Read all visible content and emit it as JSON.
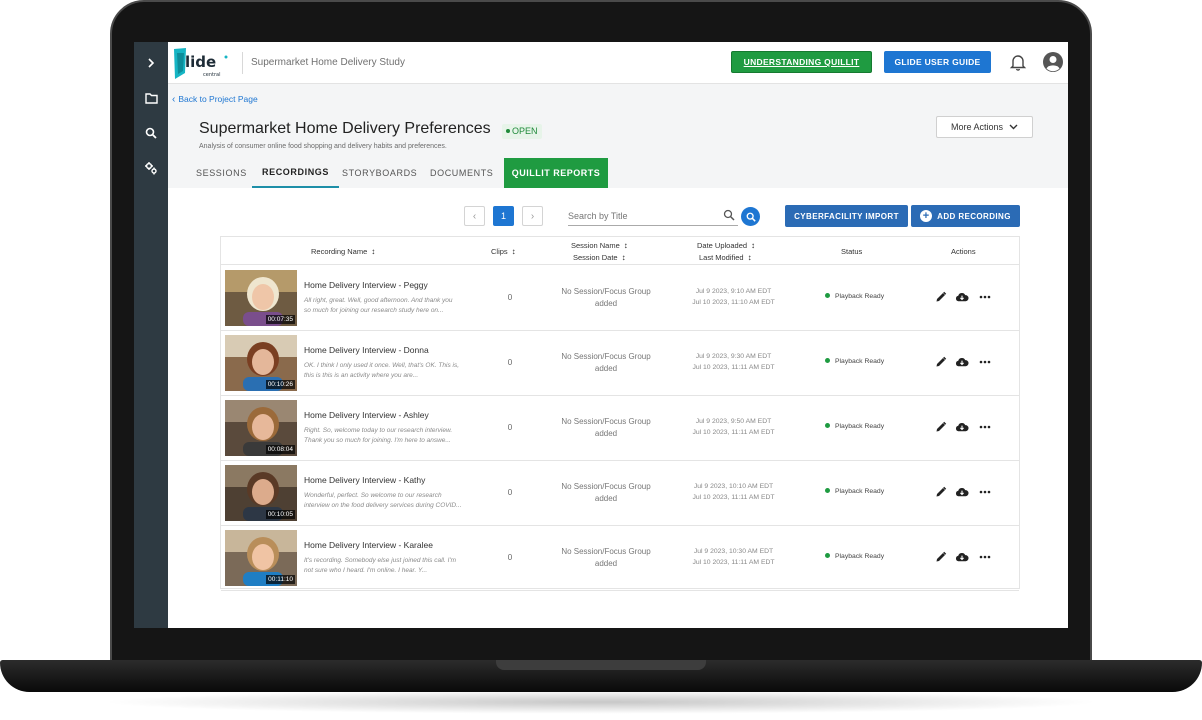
{
  "app": {
    "study_title": "Supermarket Home Delivery Study",
    "understanding_button": "UNDERSTANDING QUILLIT",
    "user_guide_button": "GLIDE USER GUIDE",
    "logo_alt": "glide central"
  },
  "rail": {
    "items": [
      "chevron-right-icon",
      "folder-icon",
      "search-icon",
      "settings-icon"
    ]
  },
  "header": {
    "back_label": "Back to Project Page",
    "title": "Supermarket Home Delivery Preferences",
    "status_badge": "OPEN",
    "subtitle": "Analysis of consumer online food shopping and delivery habits and preferences.",
    "more_actions": "More Actions"
  },
  "tabs": [
    {
      "label": "SESSIONS",
      "active": false
    },
    {
      "label": "RECORDINGS",
      "active": true
    },
    {
      "label": "STORYBOARDS",
      "active": false
    },
    {
      "label": "DOCUMENTS",
      "active": false
    },
    {
      "label": "QUILLIT REPORTS",
      "active": false
    }
  ],
  "toolbar": {
    "page": "1",
    "search_placeholder": "Search by Title",
    "cyber_import": "CYBERFACILITY IMPORT",
    "add_recording": "ADD RECORDING"
  },
  "table": {
    "columns": {
      "name": "Recording Name",
      "clips": "Clips",
      "session_name": "Session Name",
      "session_date": "Session Date",
      "date_uploaded": "Date Uploaded",
      "last_modified": "Last Modified",
      "status": "Status",
      "actions": "Actions"
    },
    "rows": [
      {
        "name": "Home Delivery Interview - Peggy",
        "snippet_1": "All right, great. Well, good afternoon. And thank you",
        "snippet_2": "so much for joining our research study here on...",
        "duration": "00:07:35",
        "clips": "0",
        "session_1": "No Session/Focus Group",
        "session_2": "added",
        "uploaded": "Jul 9 2023, 9:10 AM EDT",
        "modified": "Jul 10 2023, 11:10 AM EDT",
        "status": "Playback Ready"
      },
      {
        "name": "Home Delivery Interview - Donna",
        "snippet_1": "OK. I think I only used it once. Well, that's OK. This is,",
        "snippet_2": "this is this is an activity where you are...",
        "duration": "00:10:26",
        "clips": "0",
        "session_1": "No Session/Focus Group",
        "session_2": "added",
        "uploaded": "Jul 9 2023, 9:30 AM EDT",
        "modified": "Jul 10 2023, 11:11 AM EDT",
        "status": "Playback Ready"
      },
      {
        "name": "Home Delivery Interview - Ashley",
        "snippet_1": "Right. So, welcome today to our research interview.",
        "snippet_2": "Thank you so much for joining. I'm here to answe...",
        "duration": "00:08:04",
        "clips": "0",
        "session_1": "No Session/Focus Group",
        "session_2": "added",
        "uploaded": "Jul 9 2023, 9:50 AM EDT",
        "modified": "Jul 10 2023, 11:11 AM EDT",
        "status": "Playback Ready"
      },
      {
        "name": "Home Delivery Interview - Kathy",
        "snippet_1": "Wonderful, perfect. So welcome to our research",
        "snippet_2": "interview on the food delivery services during COVID...",
        "duration": "00:10:05",
        "clips": "0",
        "session_1": "No Session/Focus Group",
        "session_2": "added",
        "uploaded": "Jul 9 2023, 10:10 AM EDT",
        "modified": "Jul 10 2023, 11:11 AM EDT",
        "status": "Playback Ready"
      },
      {
        "name": "Home Delivery Interview - Karalee",
        "snippet_1": "It's recording. Somebody else just joined this call. I'm",
        "snippet_2": "not sure who I heard. I'm online. I hear. Y...",
        "duration": "00:11:10",
        "clips": "0",
        "session_1": "No Session/Focus Group",
        "session_2": "added",
        "uploaded": "Jul 9 2023, 10:30 AM EDT",
        "modified": "Jul 10 2023, 11:11 AM EDT",
        "status": "Playback Ready"
      }
    ]
  },
  "colors": {
    "rail": "#2e3a42",
    "green": "#1f9b41",
    "blue": "#1e76d2",
    "button_blue": "#2b6bb5",
    "tab_underline": "#1e8fa8"
  }
}
